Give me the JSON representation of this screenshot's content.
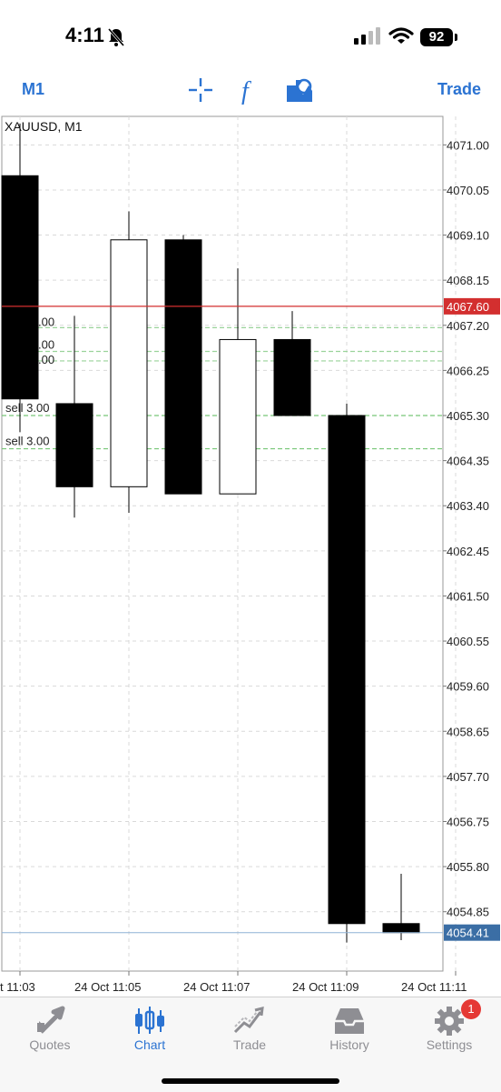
{
  "status_bar": {
    "time": "4:11",
    "battery": "92"
  },
  "toolbar": {
    "timeframe": "M1",
    "trade_label": "Trade"
  },
  "chart": {
    "symbol_label": "XAUUSD, M1",
    "current_price": "4067.60",
    "last_price": "4054.41",
    "order_labels": [
      "sell 3.00",
      "sell 3.00"
    ],
    "partial_labels": [
      ".00",
      ".00",
      ".00"
    ],
    "colors": {
      "price_line": "#d32f2f",
      "last_price": "#3b6ea5",
      "order_line": "#77c677"
    }
  },
  "chart_data": {
    "type": "candlestick",
    "title": "XAUUSD, M1",
    "y_ticks": [
      "4071.00",
      "4070.05",
      "4069.10",
      "4068.15",
      "4067.20",
      "4066.25",
      "4065.30",
      "4064.35",
      "4063.40",
      "4062.45",
      "4061.50",
      "4060.55",
      "4059.60",
      "4058.65",
      "4057.70",
      "4056.75",
      "4055.80",
      "4054.85"
    ],
    "x_ticks": [
      "t 11:03",
      "24 Oct 11:05",
      "24 Oct 11:07",
      "24 Oct 11:09",
      "24 Oct 11:11"
    ],
    "ylim": [
      4053.6,
      4071.6
    ],
    "candles": [
      {
        "time": "11:03",
        "open": 4070.35,
        "high": 4071.45,
        "low": 4064.95,
        "close": 4065.65
      },
      {
        "time": "11:04",
        "open": 4065.55,
        "high": 4067.4,
        "low": 4063.15,
        "close": 4063.8
      },
      {
        "time": "11:05",
        "open": 4063.8,
        "high": 4069.6,
        "low": 4063.25,
        "close": 4069.0
      },
      {
        "time": "11:06",
        "open": 4069.0,
        "high": 4069.1,
        "low": 4063.65,
        "close": 4063.65
      },
      {
        "time": "11:07",
        "open": 4063.65,
        "high": 4068.4,
        "low": 4063.65,
        "close": 4066.9
      },
      {
        "time": "11:08",
        "open": 4066.9,
        "high": 4067.5,
        "low": 4065.3,
        "close": 4065.3
      },
      {
        "time": "11:09",
        "open": 4065.3,
        "high": 4065.55,
        "low": 4054.2,
        "close": 4054.6
      },
      {
        "time": "11:10",
        "open": 4054.6,
        "high": 4055.65,
        "low": 4054.25,
        "close": 4054.41
      }
    ],
    "levels": {
      "current": 4067.6,
      "last": 4054.41,
      "orders": [
        4065.3,
        4064.6
      ],
      "partials": [
        4067.15,
        4066.65,
        4066.45
      ]
    }
  },
  "tabs": [
    {
      "label": "Quotes",
      "icon": "quotes-icon"
    },
    {
      "label": "Chart",
      "icon": "chart-icon"
    },
    {
      "label": "Trade",
      "icon": "trade-icon"
    },
    {
      "label": "History",
      "icon": "history-icon"
    },
    {
      "label": "Settings",
      "icon": "settings-icon",
      "badge": "1"
    }
  ]
}
